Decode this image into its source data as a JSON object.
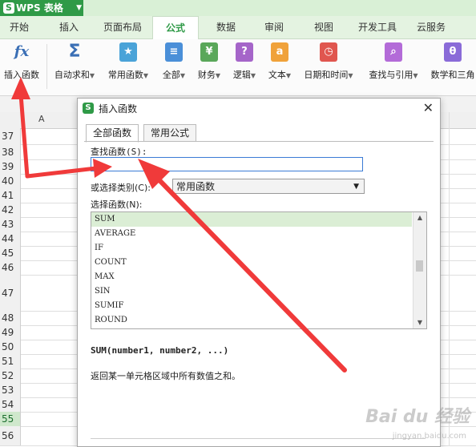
{
  "app": {
    "name": "WPS 表格",
    "logo_letter": "S"
  },
  "menu_tabs": [
    "开始",
    "插入",
    "页面布局",
    "公式",
    "数据",
    "审阅",
    "视图",
    "开发工具",
    "云服务"
  ],
  "active_tab": "公式",
  "ribbon": {
    "insert_function": "插入函数",
    "autosum": "自动求和",
    "common_functions": "常用函数",
    "all": "全部",
    "finance": "财务",
    "logic": "逻辑",
    "text": "文本",
    "datetime": "日期和时间",
    "lookup": "查找与引用",
    "math": "数学和三角"
  },
  "sheet": {
    "column_header": "A",
    "row_numbers": [
      "37",
      "38",
      "39",
      "40",
      "41",
      "42",
      "43",
      "44",
      "45",
      "46",
      "47",
      "48",
      "49",
      "50",
      "51",
      "52",
      "53",
      "54",
      "55",
      "56"
    ]
  },
  "dialog": {
    "title": "插入函数",
    "tab_all": "全部函数",
    "tab_common": "常用公式",
    "search_label": "查找函数(S):",
    "search_value": "|",
    "category_label": "或选择类别(C):",
    "category_value": "常用函数",
    "select_label": "选择函数(N):",
    "functions": [
      "SUM",
      "AVERAGE",
      "IF",
      "COUNT",
      "MAX",
      "SIN",
      "SUMIF",
      "ROUND"
    ],
    "selected_function": "SUM",
    "signature": "SUM(number1, number2, ...)",
    "description": "返回某一单元格区域中所有数值之和。"
  },
  "watermark": {
    "main": "Bai du 经验",
    "sub": "jingyan.baidu.com"
  },
  "colors": {
    "brand_green": "#2f9a47",
    "arrow_red": "#f03a3a",
    "selection_green": "#dbeed5"
  }
}
